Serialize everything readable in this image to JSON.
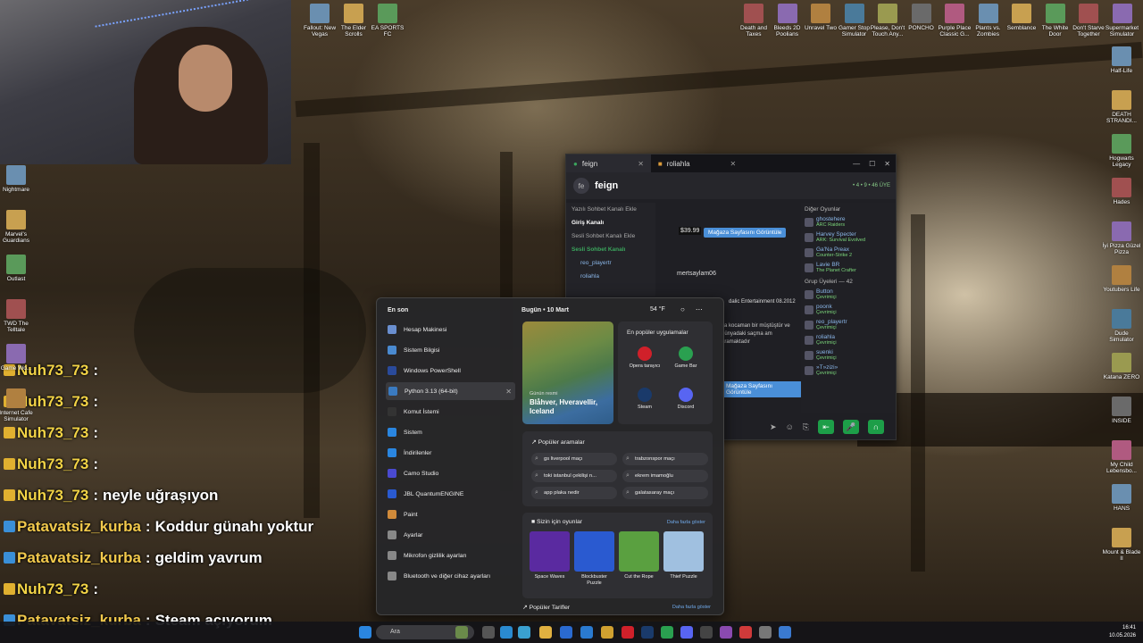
{
  "chat": [
    {
      "user": "Nuh73_73",
      "sep": ":",
      "text": ""
    },
    {
      "user": "Nuh73_73",
      "sep": ":",
      "text": ""
    },
    {
      "user": "Nuh73_73",
      "sep": ":",
      "text": ""
    },
    {
      "user": "Nuh73_73",
      "sep": ":",
      "text": ""
    },
    {
      "user": "Nuh73_73",
      "sep": ":",
      "text": "neyle uğraşıyon"
    },
    {
      "user": "Patavatsiz_kurba",
      "sep": ":",
      "text": "Koddur günahı yoktur"
    },
    {
      "user": "Patavatsiz_kurba",
      "sep": ":",
      "text": "geldim yavrum"
    },
    {
      "user": "Nuh73_73",
      "sep": ":",
      "text": ""
    },
    {
      "user": "Patavatsiz_kurba",
      "sep": ":",
      "text": "Steam açıyorum"
    }
  ],
  "desktop_top": [
    "Fallout: New Vegas",
    "The Elder Scrolls",
    "EA SPORTS FC",
    "Death and Taxes",
    "Bleeds 2D Poolians",
    "Unravel Two",
    "Gamer Stop Simulator",
    "Please, Don't Touch Any...",
    "PONCHO",
    "Purple Place Classic G...",
    "Plants vs. Zombies",
    "Semblance",
    "The White Door",
    "Don't Starve Together",
    "Supermarket Simulator"
  ],
  "desktop_right": [
    "Half-Life",
    "DEATH STRANDI...",
    "Hogwarts Legacy",
    "Hades",
    "İyi Pizza Güzel Pizza",
    "Youtubers Life",
    "Dude Simulator",
    "Katana ZERO",
    "INSIDE",
    "My Child Lebensbo...",
    "HANS",
    "Mount & Blade II"
  ],
  "desktop_left": [
    "Nightmare",
    "Marvel's Guardians",
    "Outlast",
    "TWD The Telltale",
    "Game Wo...",
    "Internet Cafe Simulator"
  ],
  "discord": {
    "tab1": "feign",
    "tab2": "roliahla",
    "server": "feign",
    "server_abbr": "fe",
    "counts": "• 4  • 9  • 46 ÜYE",
    "channels": [
      "Yazılı Sohbet Kanalı Ekle",
      "Giriş Kanalı",
      "Sesli Sohbet Kanalı Ekle",
      "Sesli Sohbet Kanalı"
    ],
    "voice_users": [
      "reo_playertr",
      "roliahla"
    ],
    "price": "$39.99",
    "store_btn": "Mağaza Sayfasını Görüntüle",
    "msg_user": "mertsaylam06",
    "msg_text": "ya kocaman bir müştüştür ve dünyadaki saçma am aramaktadır",
    "embed": "dalic Entertainment 08.2012",
    "members_other": "Diğer Oyunlar",
    "members": [
      {
        "n": "ghostehere",
        "s": "ARC Raiders"
      },
      {
        "n": "Harvey Specter",
        "s": "ARK: Survival Evolved"
      },
      {
        "n": "Ga'Na Preax",
        "s": "Counter-Strike 2"
      },
      {
        "n": "Lavie BR",
        "s": "The Planet Crafter"
      }
    ],
    "group_label": "Grup Üyeleri",
    "group_count": "42",
    "group": [
      {
        "n": "Button",
        "s": "Çevrimiçi"
      },
      {
        "n": "poonk",
        "s": "Çevrimiçi"
      },
      {
        "n": "reo_playertr",
        "s": "Çevrimiçi"
      },
      {
        "n": "roliahla",
        "s": "Çevrimiçi"
      },
      {
        "n": "suenki",
        "s": "Çevrimiçi"
      },
      {
        "n": "»T»zizi»",
        "s": "Çevrimiçi"
      }
    ]
  },
  "start": {
    "recent_title": "En son",
    "recent": [
      "Hesap Makinesi",
      "Sistem Bilgisi",
      "Windows PowerShell",
      "Python 3.13 (64-bit)",
      "Komut İstemi",
      "Sistem",
      "İndirilenler",
      "Camo Studio",
      "JBL QuantumENGINE",
      "Paint",
      "Ayarlar",
      "Mikrofon gizlilik ayarları",
      "Bluetooth ve diğer cihaz ayarları"
    ],
    "today": "Bugün • 10 Mart",
    "weather": "54 °F",
    "card_label": "Günün resmi",
    "card_title": "Blåhver, Hveravellir, Iceland",
    "apps_title": "En popüler uygulamalar",
    "apps": [
      "Opera tarayıcı",
      "Game Bar",
      "Steam",
      "Discord"
    ],
    "searches_title": "Popüler aramalar",
    "searches": [
      "gs liverpool maçı",
      "trabzonspor maçı",
      "toki istanbul çekilişi n...",
      "ekrem imamoğlu",
      "app plaka nedir",
      "galatasaray maçı"
    ],
    "games_title": "Sizin için oyunlar",
    "games_more": "Daha fazla göster",
    "games": [
      "Space Waves",
      "Blockbuster Puzzle",
      "Cut the Rope",
      "Thief Puzzle"
    ],
    "tarif": "Popüler Tarifler",
    "tarif_more": "Daha fazla göster"
  },
  "taskbar": {
    "search": "Ara",
    "time": "16:41",
    "date": "10.05.2026"
  }
}
